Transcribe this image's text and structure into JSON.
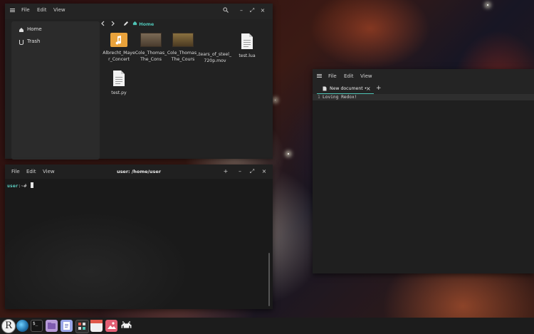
{
  "file_manager": {
    "menu": [
      "File",
      "Edit",
      "View"
    ],
    "location": "Home",
    "sidebar": [
      {
        "label": "Home",
        "icon": "home-icon"
      },
      {
        "label": "Trash",
        "icon": "trash-icon"
      }
    ],
    "files": [
      {
        "name": "Albrecht_Ma​yer_Concert",
        "kind": "audio-folder"
      },
      {
        "name": "Cole_Thoma​s_The_Cons",
        "kind": "image"
      },
      {
        "name": "Cole_Thoma​s_The_Cours",
        "kind": "image"
      },
      {
        "name": "tears_of_ste​el_720p.mov",
        "kind": "video"
      },
      {
        "name": "test.lua",
        "kind": "text"
      },
      {
        "name": "test.py",
        "kind": "text"
      }
    ]
  },
  "editor": {
    "menu": [
      "File",
      "Edit",
      "View"
    ],
    "tab_label": "New document •",
    "close_tab": "×",
    "add_tab": "+",
    "line_number": "1",
    "line_text": "Loving Redox!"
  },
  "terminal": {
    "menu": [
      "File",
      "Edit",
      "View"
    ],
    "title": "user: /home/user",
    "prompt_user": "user",
    "prompt_rest": ":~#",
    "controls": {
      "add": "+",
      "minimize": "–",
      "maximize": "⤢",
      "close": "×"
    }
  },
  "window_controls": {
    "minimize": "–",
    "maximize": "⤢",
    "close": "×"
  },
  "taskbar": {
    "launcher": "R",
    "terminal_glyph": "$_"
  },
  "colors": {
    "accent": "#4fc3b5",
    "folder": "#e9a23b",
    "prompt": "#5fd3c6"
  }
}
